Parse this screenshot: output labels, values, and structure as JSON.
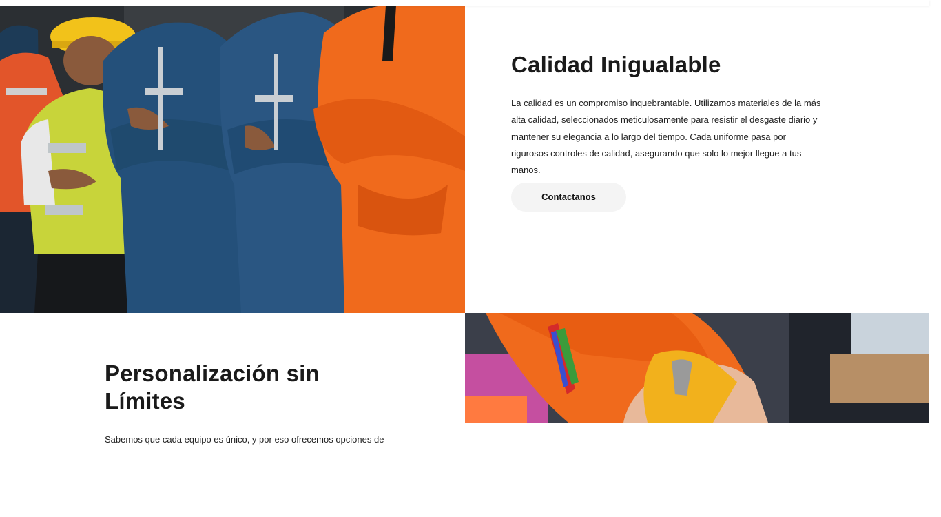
{
  "sections": [
    {
      "title": "Calidad Inigualable",
      "body": "La calidad es un compromiso inquebrantable. Utilizamos materiales de la más alta calidad, seleccionados meticulosamente para resistir el desgaste diario y mantener su elegancia a lo largo del tiempo. Cada uniforme pasa por rigurosos controles de calidad, asegurando que solo lo mejor llegue a tus manos.",
      "button_label": "Contactanos",
      "image_icon": "workers-in-uniforms-photo"
    },
    {
      "title": "Personalización sin Límites",
      "body": "Sabemos que cada equipo es único, y por eso ofrecemos opciones de",
      "image_icon": "writing-hand-photo"
    }
  ],
  "colors": {
    "button_bg": "#f4f4f4",
    "heading": "#1a1a1a",
    "orange": "#f06a1c",
    "navy": "#1f4a6e",
    "yellow": "#f2c21a"
  }
}
